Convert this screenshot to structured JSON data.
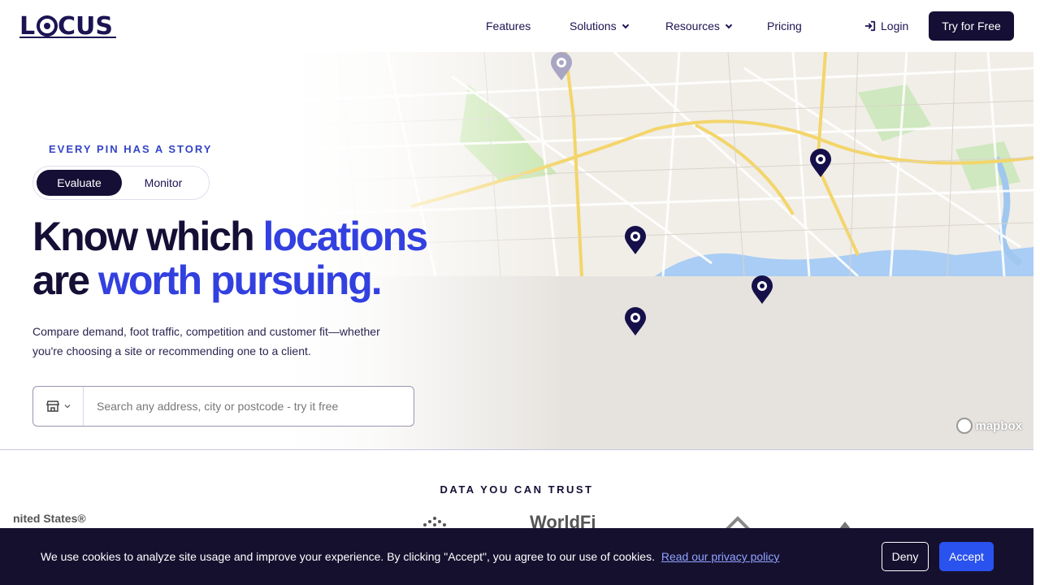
{
  "brand": {
    "name": "LOCUS"
  },
  "nav": {
    "features": "Features",
    "solutions": "Solutions",
    "resources": "Resources",
    "pricing": "Pricing",
    "login": "Login",
    "try_free": "Try for Free"
  },
  "hero": {
    "eyebrow": "EVERY PIN HAS A STORY",
    "toggle": {
      "active": "Evaluate",
      "inactive": "Monitor"
    },
    "headline": {
      "part1": "Know which ",
      "accent1": "locations",
      "part2": "are ",
      "accent2": "worth pursuing."
    },
    "subtitle": "Compare demand, foot traffic, competition and customer fit—whether you're choosing a site or recommending one to a client.",
    "search": {
      "placeholder": "Search any address, city or postcode - try it free",
      "type_icon": "store-icon"
    },
    "map_attribution": "mapbox"
  },
  "trust": {
    "title": "DATA YOU CAN TRUST",
    "logos": [
      "nited States®",
      "WorldFi"
    ]
  },
  "cookie": {
    "text": "We use cookies to analyze site usage and improve your experience. By clicking \"Accept\", you agree to our use of cookies.",
    "link": "Read our privacy policy",
    "deny": "Deny",
    "accept": "Accept"
  },
  "colors": {
    "navy": "#150f36",
    "accent": "#3340e0",
    "accept": "#2952ef"
  }
}
